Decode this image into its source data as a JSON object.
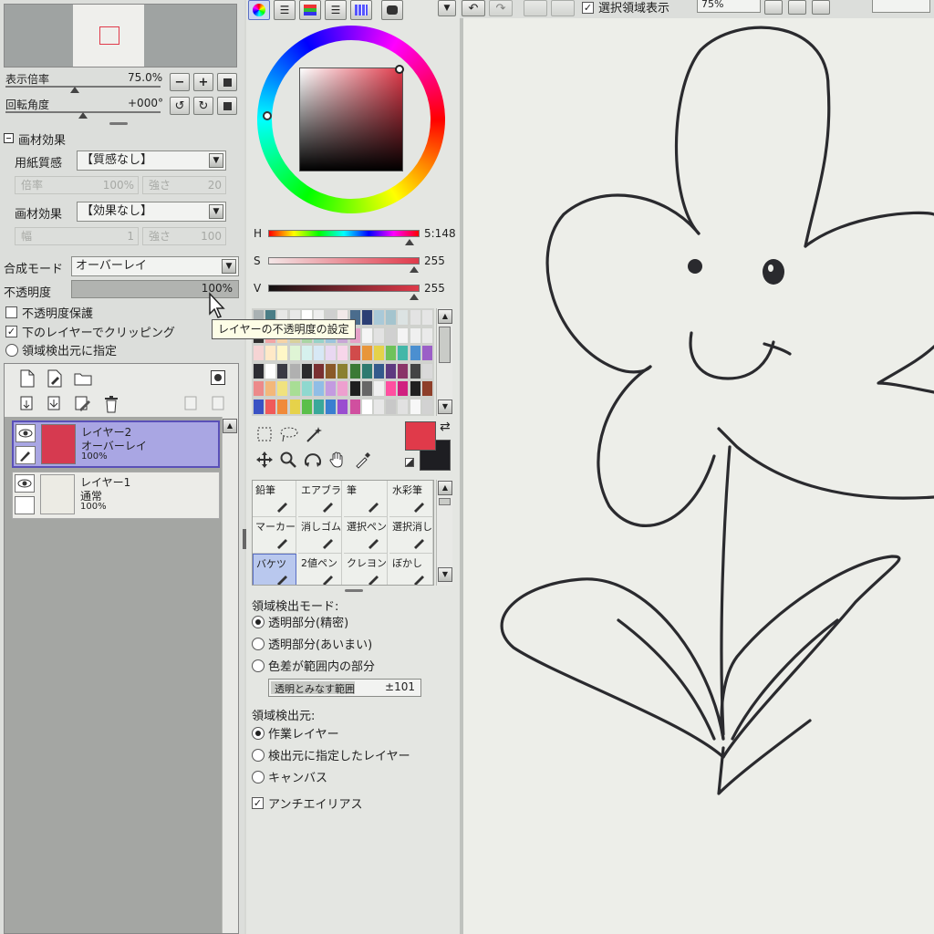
{
  "top_bar": {
    "selection_display_label": "選択領域表示",
    "zoom_value": "75%"
  },
  "navigator": {
    "zoom_label": "表示倍率",
    "zoom_value": "75.0%",
    "rotation_label": "回転角度",
    "rotation_value": "+000°"
  },
  "material_effects": {
    "header": "画材効果",
    "paper_texture_label": "用紙質感",
    "paper_texture_value": "【質感なし】",
    "paper_scale_label": "倍率",
    "paper_scale_value": "100%",
    "paper_strength_label": "強さ",
    "paper_strength_value": "20",
    "effect_label": "画材効果",
    "effect_value": "【効果なし】",
    "effect_width_label": "幅",
    "effect_width_value": "1",
    "effect_strength_label": "強さ",
    "effect_strength_value": "100"
  },
  "layer_props": {
    "blend_mode_label": "合成モード",
    "blend_mode_value": "オーバーレイ",
    "opacity_label": "不透明度",
    "opacity_value": "100%",
    "opacity_tooltip": "レイヤーの不透明度の設定",
    "preserve_opacity_label": "不透明度保護",
    "clipping_label": "下のレイヤーでクリッピング",
    "selection_source_label": "領域検出元に指定"
  },
  "layers": [
    {
      "name": "レイヤー2",
      "mode": "オーバーレイ",
      "opacity": "100%",
      "color": "#d63a50",
      "selected": true
    },
    {
      "name": "レイヤー1",
      "mode": "通常",
      "opacity": "100%",
      "color": "#ecebe4",
      "selected": false
    }
  ],
  "color_panel": {
    "h_label": "H",
    "h_value": "5:148",
    "h_level": 0.97,
    "s_label": "S",
    "s_value": "255",
    "s_level": 1.0,
    "v_label": "V",
    "v_value": "255",
    "v_level": 1.0,
    "fg_color": "#e03a4a",
    "bg_color": "#1e1e22"
  },
  "swatches": [
    "#a9b1b3",
    "#4a7d86",
    "#e7e8e6",
    "#e8e8e8",
    "#ffffff",
    "#eeeeee",
    "#cfcfcf",
    "#f2e9e9",
    "#4a6c8d",
    "#2c3f75",
    "#a9c9d8",
    "#a4c4ce",
    "#dce3e3",
    "#e3e3e3",
    "#e5e5e5",
    "#2f2f2f",
    "#f2a5a5",
    "#f5d3a7",
    "#d8d19c",
    "#a9d5a3",
    "#96d2c8",
    "#9bc4dc",
    "#c8a6d5",
    "#e5a2c8",
    "#f5f5f5",
    "#e2e2e2",
    "#d0d0d0",
    "#f4f4f4",
    "#f0f0f0",
    "#eaeaea",
    "#f6d4d4",
    "#ffe9c7",
    "#fff7c7",
    "#dff5d5",
    "#d6f1ee",
    "#d7e8f5",
    "#e9d8f2",
    "#f7d6ea",
    "#d14b4b",
    "#e8963a",
    "#e4d24a",
    "#6fc25a",
    "#43b7a8",
    "#4b8fd0",
    "#9b5fc7",
    "#2d2d33",
    "#ffffff",
    "#3a3a44",
    "#b0b0b0",
    "#2b2b2b",
    "#7a3030",
    "#8a5a28",
    "#8a8030",
    "#3b7a35",
    "#2e7a70",
    "#335a8c",
    "#5e3a80",
    "#8a3468",
    "#444444",
    "#d9d9d9",
    "#ec8a8a",
    "#f3b77a",
    "#f0e27f",
    "#a8de95",
    "#8fd8cf",
    "#90bde6",
    "#c39be0",
    "#eda0cf",
    "#1f1f1f",
    "#666666",
    "#f0f0f0",
    "#ff4fa0",
    "#d02080",
    "#202020",
    "#8e3f2a",
    "#3a52c4",
    "#f05a5a",
    "#f08a3a",
    "#e6d24a",
    "#5abf4a",
    "#3aa89a",
    "#3a7fd0",
    "#9a4fd0",
    "#d04f9f",
    "#ffffff",
    "#e7e7e7",
    "#c8c8c8",
    "#e1e1e1",
    "#f7f7f7",
    "#d2d2d2"
  ],
  "tools": [
    {
      "label": "鉛筆",
      "selected": false
    },
    {
      "label": "エアブラシ",
      "selected": false
    },
    {
      "label": "筆",
      "selected": false
    },
    {
      "label": "水彩筆",
      "selected": false
    },
    {
      "label": "マーカー",
      "selected": false
    },
    {
      "label": "消しゴム",
      "selected": false
    },
    {
      "label": "選択ペン",
      "selected": false
    },
    {
      "label": "選択消し",
      "selected": false
    },
    {
      "label": "バケツ",
      "selected": true
    },
    {
      "label": "2値ペン",
      "selected": false
    },
    {
      "label": "クレヨン",
      "selected": false
    },
    {
      "label": "ぼかし",
      "selected": false
    }
  ],
  "bucket_settings": {
    "detect_mode_label": "領域検出モード:",
    "mode_options": [
      "透明部分(精密)",
      "透明部分(あいまい)",
      "色差が範囲内の部分"
    ],
    "mode_selected": 0,
    "range_label": "透明とみなす範囲",
    "range_value": "±101",
    "detect_source_label": "領域検出元:",
    "source_options": [
      "作業レイヤー",
      "検出元に指定したレイヤー",
      "キャンバス"
    ],
    "source_selected": 0,
    "antialias_label": "アンチエイリアス"
  },
  "colors": {
    "panel_bg": "#e4e6e2",
    "canvas_bg": "#edeee9",
    "selected_layer": "#a9a6e3",
    "accent_red": "#d63a50"
  }
}
